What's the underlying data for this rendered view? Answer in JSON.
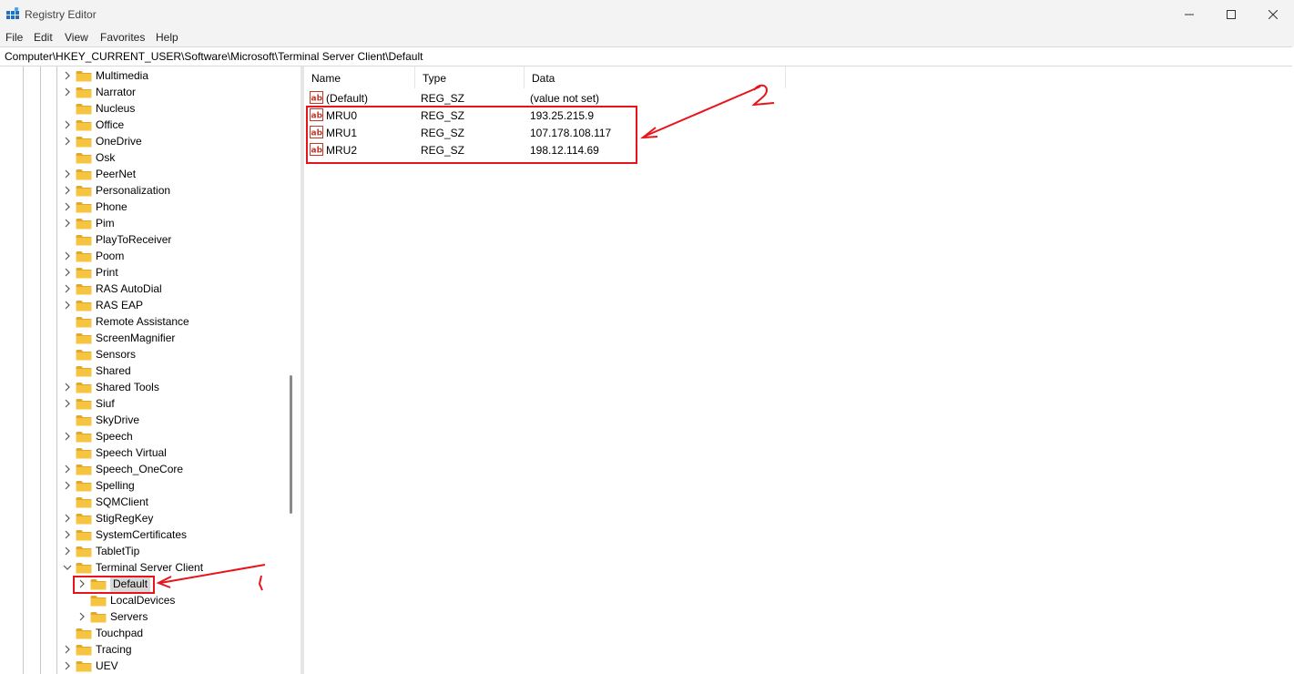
{
  "window": {
    "title": "Registry Editor",
    "minimize_icon": "minimize-icon",
    "maximize_icon": "maximize-icon",
    "close_icon": "close-icon"
  },
  "menu": [
    "File",
    "Edit",
    "View",
    "Favorites",
    "Help"
  ],
  "address": "Computer\\HKEY_CURRENT_USER\\Software\\Microsoft\\Terminal Server Client\\Default",
  "tree": [
    {
      "label": "Multimedia",
      "expander": "collapsed",
      "level": 0
    },
    {
      "label": "Narrator",
      "expander": "collapsed",
      "level": 0
    },
    {
      "label": "Nucleus",
      "expander": "none",
      "level": 0
    },
    {
      "label": "Office",
      "expander": "collapsed",
      "level": 0
    },
    {
      "label": "OneDrive",
      "expander": "collapsed",
      "level": 0
    },
    {
      "label": "Osk",
      "expander": "none",
      "level": 0
    },
    {
      "label": "PeerNet",
      "expander": "collapsed",
      "level": 0
    },
    {
      "label": "Personalization",
      "expander": "collapsed",
      "level": 0
    },
    {
      "label": "Phone",
      "expander": "collapsed",
      "level": 0
    },
    {
      "label": "Pim",
      "expander": "collapsed",
      "level": 0
    },
    {
      "label": "PlayToReceiver",
      "expander": "none",
      "level": 0
    },
    {
      "label": "Poom",
      "expander": "collapsed",
      "level": 0
    },
    {
      "label": "Print",
      "expander": "collapsed",
      "level": 0
    },
    {
      "label": "RAS AutoDial",
      "expander": "collapsed",
      "level": 0
    },
    {
      "label": "RAS EAP",
      "expander": "collapsed",
      "level": 0
    },
    {
      "label": "Remote Assistance",
      "expander": "none",
      "level": 0
    },
    {
      "label": "ScreenMagnifier",
      "expander": "none",
      "level": 0
    },
    {
      "label": "Sensors",
      "expander": "none",
      "level": 0
    },
    {
      "label": "Shared",
      "expander": "none",
      "level": 0
    },
    {
      "label": "Shared Tools",
      "expander": "collapsed",
      "level": 0
    },
    {
      "label": "Siuf",
      "expander": "collapsed",
      "level": 0
    },
    {
      "label": "SkyDrive",
      "expander": "none",
      "level": 0
    },
    {
      "label": "Speech",
      "expander": "collapsed",
      "level": 0
    },
    {
      "label": "Speech Virtual",
      "expander": "none",
      "level": 0
    },
    {
      "label": "Speech_OneCore",
      "expander": "collapsed",
      "level": 0
    },
    {
      "label": "Spelling",
      "expander": "collapsed",
      "level": 0
    },
    {
      "label": "SQMClient",
      "expander": "none",
      "level": 0
    },
    {
      "label": "StigRegKey",
      "expander": "collapsed",
      "level": 0
    },
    {
      "label": "SystemCertificates",
      "expander": "collapsed",
      "level": 0
    },
    {
      "label": "TabletTip",
      "expander": "collapsed",
      "level": 0
    },
    {
      "label": "Terminal Server Client",
      "expander": "expanded",
      "level": 0
    },
    {
      "label": "Default",
      "expander": "collapsed",
      "level": 1,
      "selected": true
    },
    {
      "label": "LocalDevices",
      "expander": "none",
      "level": 1
    },
    {
      "label": "Servers",
      "expander": "collapsed",
      "level": 1
    },
    {
      "label": "Touchpad",
      "expander": "none",
      "level": 0
    },
    {
      "label": "Tracing",
      "expander": "collapsed",
      "level": 0
    },
    {
      "label": "UEV",
      "expander": "collapsed",
      "level": 0
    }
  ],
  "columns": {
    "name": "Name",
    "type": "Type",
    "data": "Data"
  },
  "values": [
    {
      "name": "(Default)",
      "type": "REG_SZ",
      "data": "(value not set)",
      "icon": "string-value-icon"
    },
    {
      "name": "MRU0",
      "type": "REG_SZ",
      "data": "193.25.215.9",
      "icon": "string-value-icon"
    },
    {
      "name": "MRU1",
      "type": "REG_SZ",
      "data": "107.178.108.117",
      "icon": "string-value-icon"
    },
    {
      "name": "MRU2",
      "type": "REG_SZ",
      "data": "198.12.114.69",
      "icon": "string-value-icon"
    }
  ],
  "annotations": {
    "mark1": "1",
    "mark2": "2",
    "color": "#e8141c"
  },
  "colors": {
    "folder": "#f5c542",
    "folder_dark": "#e0a82e",
    "accent": "#0067c0",
    "selection": "#d9d9d9"
  }
}
